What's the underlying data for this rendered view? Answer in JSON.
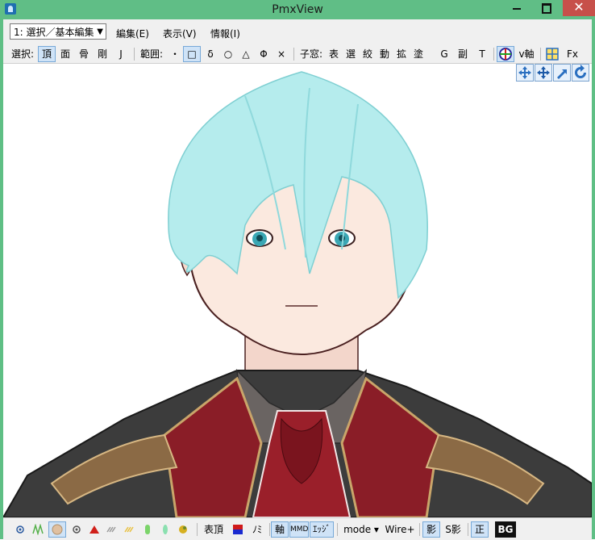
{
  "window": {
    "title": "PmxView",
    "min_label": "",
    "max_label": "",
    "close_label": "✕"
  },
  "menubar": {
    "mode_select_value": "1: 選択／基本編集",
    "items": [
      "編集(E)",
      "表示(V)",
      "情報(I)"
    ]
  },
  "toolbar": {
    "select_label": "選択:",
    "select_items": [
      "頂",
      "面",
      "骨",
      "剛",
      "J"
    ],
    "range_label": "範囲:",
    "range_items": [
      "・",
      "□",
      "δ",
      "○",
      "△",
      "Φ",
      "×"
    ],
    "child_window_label": "子窓:",
    "child_window_items": [
      "表",
      "選",
      "絞",
      "動",
      "拡",
      "塗",
      "G",
      "副",
      "T"
    ],
    "vaxis_label": "v軸",
    "fx_label": "Fx"
  },
  "statusbar": {
    "table_vertex_label": "表頂",
    "no_label": "ﾉﾐ",
    "axis_label": "軸",
    "mmd_label": "MMD",
    "edge_label": "ｴｯｼﾞ",
    "mode_label": "mode ▾",
    "wire_label": "Wire+",
    "shadow_label": "影",
    "sshadow_label": "S影",
    "front_label": "正",
    "bg_label": "BG"
  },
  "colors": {
    "titlebar": "#60be86",
    "close": "#c7504a",
    "selected": "#cfe3f7",
    "hair": "#aee7e8",
    "skin": "#f9e6dc",
    "jacket": "#3a3a3a",
    "tie": "#8c1c26"
  }
}
